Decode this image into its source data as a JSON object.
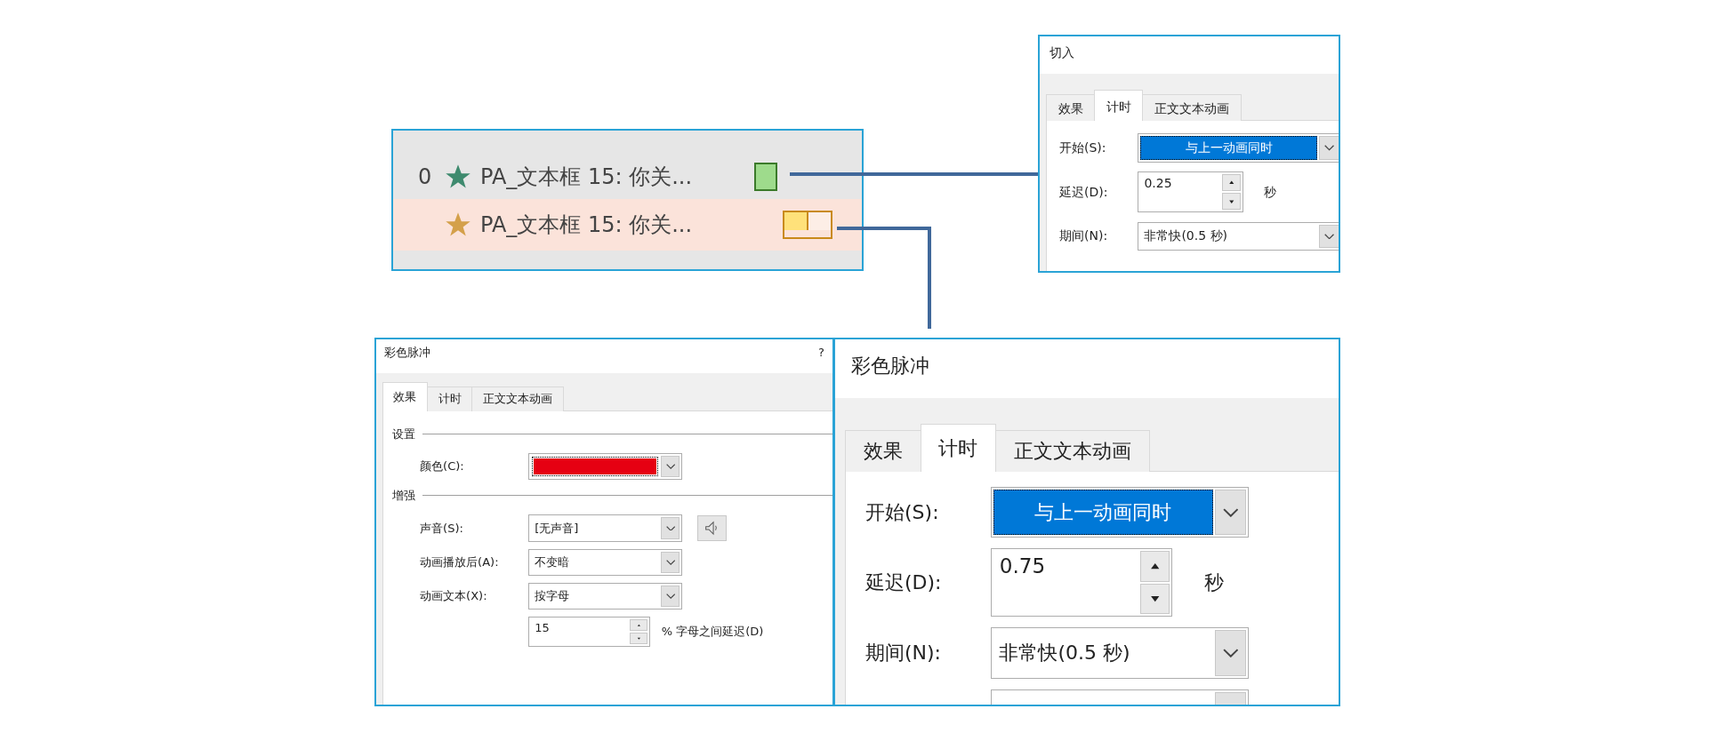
{
  "animation_pane": {
    "items": [
      {
        "order": "0",
        "label": "PA_文本框 15: 你关...",
        "color": "#3e8a6e",
        "selected": false,
        "kind": "solid"
      },
      {
        "label": "PA_文本框 15: 你关...",
        "color": "#d4a04a",
        "selected": true,
        "kind": "split"
      }
    ]
  },
  "dialogs": [
    {
      "title": "切入",
      "tabs": [
        {
          "label": "效果",
          "selected": false
        },
        {
          "label": "计时",
          "selected": true
        },
        {
          "label": "正文文本动画",
          "selected": false
        }
      ],
      "fields": [
        {
          "kind": "dropdown",
          "label": "开始(S):",
          "value": "与上一动画同时",
          "highlighted": true
        },
        {
          "kind": "spinner",
          "label": "延迟(D):",
          "value": "0.25",
          "unit": "秒"
        },
        {
          "kind": "dropdown",
          "label": "期间(N):",
          "value": "非常快(0.5 秒)",
          "highlighted": false
        }
      ]
    },
    {
      "title": "彩色脉冲",
      "help": "?",
      "tabs": [
        {
          "label": "效果",
          "selected": true
        },
        {
          "label": "计时",
          "selected": false
        },
        {
          "label": "正文文本动画",
          "selected": false
        }
      ],
      "sections": [
        {
          "heading": "设置",
          "fields": [
            {
              "kind": "color",
              "label": "颜色(C):",
              "color": "#e60012"
            }
          ]
        },
        {
          "heading": "增强",
          "fields": [
            {
              "kind": "dropdown",
              "label": "声音(S):",
              "value": "[无声音]",
              "highlighted": false,
              "sound_button": true
            },
            {
              "kind": "dropdown",
              "label": "动画播放后(A):",
              "value": "不变暗",
              "highlighted": false
            },
            {
              "kind": "dropdown",
              "label": "动画文本(X):",
              "value": "按字母",
              "highlighted": false
            },
            {
              "kind": "spinner",
              "value": "15",
              "unit": "% 字母之间延迟(D)"
            }
          ]
        }
      ]
    },
    {
      "title": "彩色脉冲",
      "tabs": [
        {
          "label": "效果",
          "selected": false
        },
        {
          "label": "计时",
          "selected": true
        },
        {
          "label": "正文文本动画",
          "selected": false
        }
      ],
      "fields": [
        {
          "kind": "dropdown",
          "label": "开始(S):",
          "value": "与上一动画同时",
          "highlighted": true
        },
        {
          "kind": "spinner",
          "label": "延迟(D):",
          "value": "0.75",
          "unit": "秒"
        },
        {
          "kind": "dropdown",
          "label": "期间(N):",
          "value": "非常快(0.5 秒)",
          "highlighted": false
        },
        {
          "kind": "dropdown"
        }
      ]
    }
  ]
}
